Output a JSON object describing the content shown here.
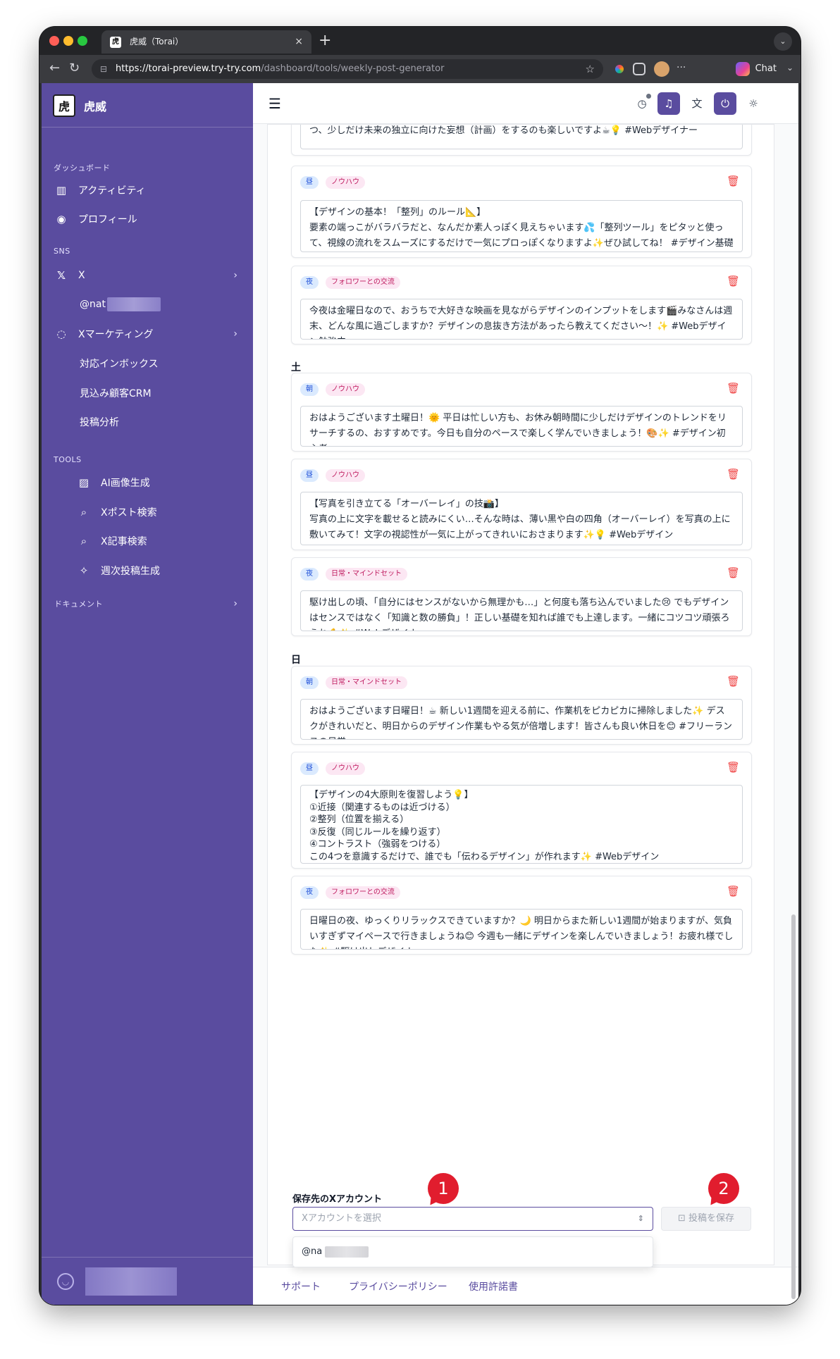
{
  "browser": {
    "tab_title": "虎威（Torai）",
    "tab_close": "×",
    "new_tab": "+",
    "url_host": "https://torai-preview.try-try.com",
    "url_path": "/dashboard/tools/weekly-post-generator",
    "chat_label": "Chat",
    "more_label": "···"
  },
  "sidebar": {
    "brand": "虎威",
    "sections": {
      "dashboard": "ダッシュボード",
      "sns": "SNS",
      "tools": "TOOLS",
      "docs": "ドキュメント"
    },
    "items": {
      "activity": "アクティビティ",
      "profile": "プロフィール",
      "x": "X",
      "x_account": "@nat",
      "x_marketing": "Xマーケティング",
      "inbox": "対応インボックス",
      "crm": "見込み顧客CRM",
      "analytics": "投稿分析",
      "ai_image": "AI画像生成",
      "x_search": "Xポスト検索",
      "x_article": "X記事検索",
      "weekly": "週次投稿生成"
    }
  },
  "posts": {
    "fri_morning_tail": "おはようございます！金曜日ですね✨今週もよく頑張りました！週末は思いっきりリフレッシュしつつ、少しだけ未来の独立に向けた妄想（計画）をするのも楽しいですよ☕💡 #Webデザイナー",
    "fri_noon": {
      "time": "昼",
      "category": "ノウハウ",
      "text": "【デザインの基本！「整列」のルール📐】\n要素の端っこがバラバラだと、なんだか素人っぽく見えちゃいます💦「整列ツール」をピタッと使って、視線の流れをスムーズにするだけで一気にプロっぽくなりますよ✨ぜひ試してね！ #デザイン基礎"
    },
    "fri_night": {
      "time": "夜",
      "category": "フォロワーとの交流",
      "text": "今夜は金曜日なので、おうちで大好きな映画を見ながらデザインのインプットをします🎬みなさんは週末、どんな風に過ごしますか？デザインの息抜き方法があったら教えてください〜！✨ #Webデザイン勉強中"
    },
    "sat_label": "土",
    "sat_morning": {
      "time": "朝",
      "category": "ノウハウ",
      "text": "おはようございます土曜日！🌞 平日は忙しい方も、お休み朝時間に少しだけデザインのトレンドをリサーチするの、おすすめです。今日も自分のペースで楽しく学んでいきましょう！🎨✨ #デザイン初心者"
    },
    "sat_noon": {
      "time": "昼",
      "category": "ノウハウ",
      "text": "【写真を引き立てる「オーバーレイ」の技📸】\n写真の上に文字を載せると読みにくい…そんな時は、薄い黒や白の四角（オーバーレイ）を写真の上に敷いてみて！文字の視認性が一気に上がってきれいにおさまります✨💡 #Webデザイン"
    },
    "sat_night": {
      "time": "夜",
      "category": "日常・マインドセット",
      "text": "駆け出しの頃、「自分にはセンスがないから無理かも…」と何度も落ち込んでいました😢 でもデザインはセンスではなく「知識と数の勝負」！正しい基礎を知れば誰でも上達します。一緒にコツコツ頑張ろうね💪✨ #Webデザイナー"
    },
    "sun_label": "日",
    "sun_morning": {
      "time": "朝",
      "category": "日常・マインドセット",
      "text": "おはようございます日曜日！☕ 新しい1週間を迎える前に、作業机をピカピカに掃除しました✨ デスクがきれいだと、明日からのデザイン作業もやる気が倍増します！皆さんも良い休日を😊 #フリーランスの日常"
    },
    "sun_noon": {
      "time": "昼",
      "category": "ノウハウ",
      "text": "【デザインの4大原則を復習しよう💡】\n①近接（関連するものは近づける）\n②整列（位置を揃える）\n③反復（同じルールを繰り返す）\n④コントラスト（強弱をつける）\nこの4つを意識するだけで、誰でも「伝わるデザイン」が作れます✨ #Webデザイン"
    },
    "sun_night": {
      "time": "夜",
      "category": "フォロワーとの交流",
      "text": "日曜日の夜、ゆっくりリラックスできていますか？🌙 明日からまた新しい1週間が始まりますが、気負いすぎずマイペースで行きましょうね😊 今週も一緒にデザインを楽しんでいきましょう！お疲れ様でした✨ #駆け出しデザイナー"
    }
  },
  "save": {
    "label": "保存先のXアカウント",
    "placeholder": "Xアカウントを選択",
    "button": "投稿を保存",
    "option": "@na"
  },
  "callouts": {
    "one": "1",
    "two": "2"
  },
  "footer": {
    "support": "サポート",
    "privacy": "プライバシーポリシー",
    "terms": "使用許諾書"
  },
  "colors": {
    "sidebar": "#5a4c9f",
    "accent": "#5a4c9f",
    "danger": "#ef4444",
    "callout": "#e11d2e"
  }
}
